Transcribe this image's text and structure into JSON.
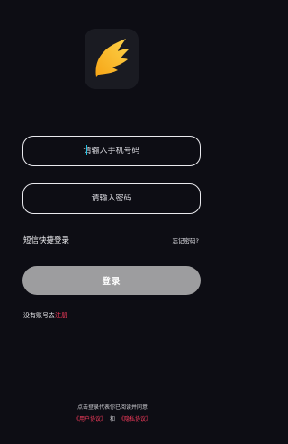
{
  "login": {
    "phone_placeholder": "请输入手机号码",
    "password_placeholder": "请输入密码",
    "sms_login": "短信快捷登录",
    "forgot_password": "忘记密码?",
    "login_button": "登录",
    "no_account": "没有账号去",
    "register": "注册"
  },
  "agreement": {
    "notice": "点击登录代表你已阅读并同意",
    "user_agreement": "《用户协议》",
    "and": "和",
    "privacy_policy": "《隐私协议》"
  },
  "colors": {
    "background": "#0d0d14",
    "accent": "#ff3d5f",
    "button": "#9d9d9f",
    "logo_gold": "#f6b21b"
  },
  "icons": {
    "logo": "wing-logo-icon"
  }
}
